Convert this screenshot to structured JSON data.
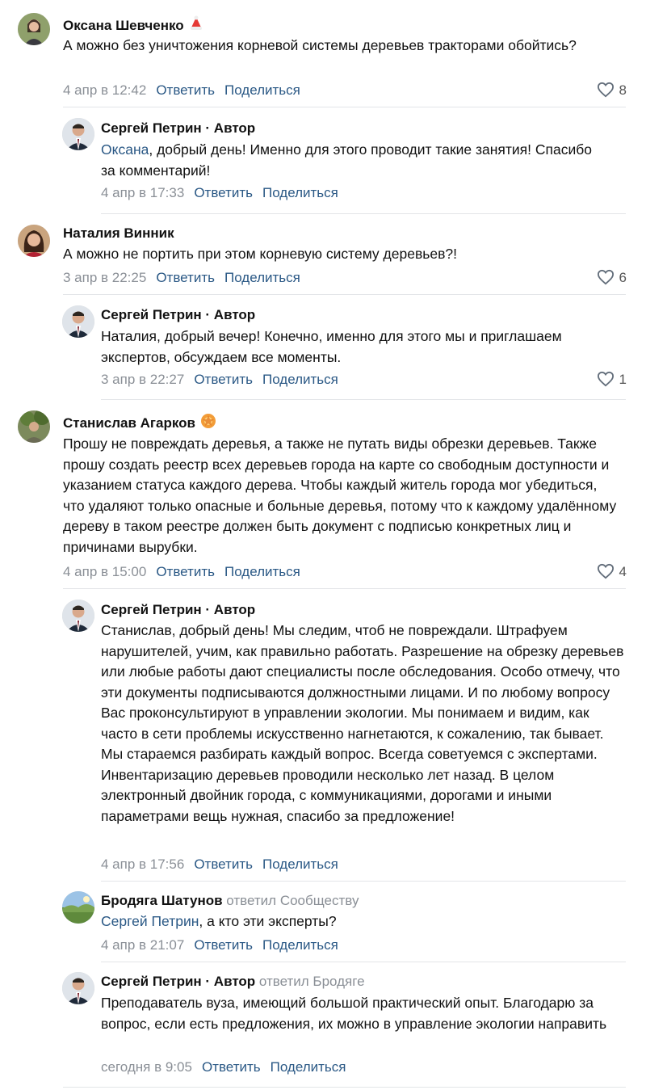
{
  "comments": [
    {
      "author": "Оксана Шевченко",
      "text": "А можно без уничтожения корневой системы деревьев тракторами обойтись?",
      "date": "4 апр в 12:42",
      "reply": "Ответить",
      "share": "Поделиться",
      "likes": "8"
    },
    {
      "author": "Сергей Петрин",
      "role": " · Автор",
      "mention": "Оксана",
      "text": ", добрый день! Именно для этого проводит такие занятия! Спасибо за комментарий!",
      "date": "4 апр в 17:33",
      "reply": "Ответить",
      "share": "Поделиться"
    },
    {
      "author": "Наталия Винник",
      "text": "А можно не портить при этом корневую систему деревьев?!",
      "date": "3 апр в 22:25",
      "reply": "Ответить",
      "share": "Поделиться",
      "likes": "6"
    },
    {
      "author": "Сергей Петрин",
      "role": " · Автор",
      "text": "Наталия, добрый вечер! Конечно, именно для этого мы и приглашаем экспертов, обсуждаем все моменты.",
      "date": "3 апр в 22:27",
      "reply": "Ответить",
      "share": "Поделиться",
      "likes": "1"
    },
    {
      "author": "Станислав Агарков",
      "text": "Прошу не повреждать деревья, а также не путать виды обрезки деревьев. Также прошу создать реестр всех деревьев города на карте со свободным доступности и указанием статуса каждого дерева. Чтобы каждый житель города мог убедиться, что удаляют только опасные и больные деревья, потому что к каждому удалённому дереву в таком реестре должен быть документ с подписью конкретных лиц и причинами вырубки.",
      "date": "4 апр в 15:00",
      "reply": "Ответить",
      "share": "Поделиться",
      "likes": "4"
    },
    {
      "author": "Сергей Петрин",
      "role": " · Автор",
      "text": "Станислав, добрый день! Мы следим, чтоб не повреждали. Штрафуем нарушителей, учим, как правильно работать. Разрешение на обрезку деревьев или любые работы дают специалисты после обследования. Особо отмечу, что эти документы подписываются должностными лицами. И по любому вопросу Вас проконсультируют в управлении экологии. Мы понимаем и видим, как часто в сети проблемы искусственно нагнетаются, к сожалению, так бывает. Мы стараемся разбирать каждый вопрос. Всегда советуемся с экспертами. Инвентаризацию деревьев проводили несколько лет назад. В целом электронный двойник города, с коммуникациями, дорогами и иными параметрами вещь нужная, спасибо за предложение!",
      "date": "4 апр в 17:56",
      "reply": "Ответить",
      "share": "Поделиться"
    },
    {
      "author": "Бродяга Шатунов",
      "replied": " ответил Сообществу",
      "mention": "Сергей Петрин",
      "text": ", а кто эти эксперты?",
      "date": "4 апр в 21:07",
      "reply": "Ответить",
      "share": "Поделиться"
    },
    {
      "author": "Сергей Петрин",
      "role": " · Автор",
      "replied": " ответил Бродяге",
      "text": "Преподаватель вуза, имеющий большой практический опыт. Благодарю за вопрос, если есть предложения, их можно в управление экологии направить",
      "date": "сегодня в 9:05",
      "reply": "Ответить",
      "share": "Поделиться"
    }
  ],
  "colors": {
    "link": "#2a5885",
    "meta": "#8a8f96",
    "divider": "#e3e5e8"
  },
  "icons": {
    "like": "heart-icon",
    "santa_badge": "santa-hat-icon",
    "cookie_badge": "emoji-badge-icon"
  }
}
